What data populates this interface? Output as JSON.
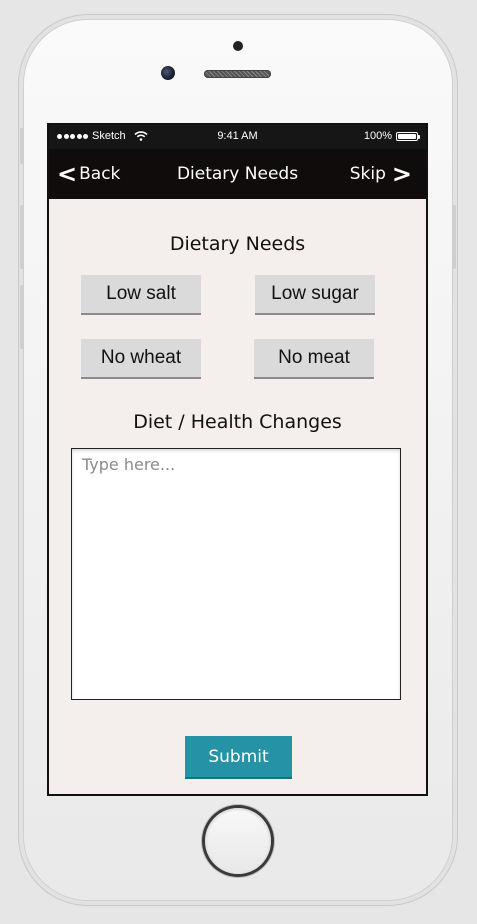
{
  "status_bar": {
    "carrier": "Sketch",
    "time": "9:41 AM",
    "battery": "100%"
  },
  "nav": {
    "back_label": "Back",
    "title": "Dietary Needs",
    "skip_label": "Skip"
  },
  "dietary": {
    "heading": "Dietary Needs",
    "options": [
      "Low salt",
      "Low sugar",
      "No wheat",
      "No meat"
    ]
  },
  "changes": {
    "heading": "Diet / Health Changes",
    "placeholder": "Type here..."
  },
  "submit_label": "Submit",
  "colors": {
    "accent": "#2592a6",
    "nav_bg": "#100c0b",
    "content_bg": "#f4efec"
  }
}
